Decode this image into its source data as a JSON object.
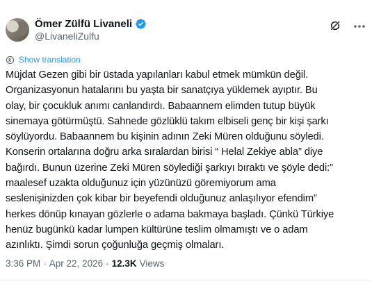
{
  "author": {
    "display_name": "Ömer Zülfü Livaneli",
    "handle": "@LivaneliZulfu",
    "verified_color": "#1d9bf0"
  },
  "header_icons": [
    "grok-icon",
    "more-icon"
  ],
  "translate": {
    "label": "Show translation",
    "icon": "translate-icon"
  },
  "tweet": {
    "text": "Müjdat Gezen gibi bir üstada yapılanları kabul etmek mümkün değil.\nOrganizasyonun hatalarını bu yaşta bir sanatçıya yüklemek ayıptır. Bu\nolay, bir çocukluk anımı canlandırdı. Babaannem elimden tutup büyük\nsinemaya götürmüştü. Sahnede gözlüklü takım elbiseli genç bir kişi şarkı\nsöylüyordu. Babaannem bu kişinin adının Zeki Müren olduğunu söyledi.\nKonserin ortalarına doğru arka sıralardan  birisi “ Helal Zekiye abla” diye\nbağırdı.  Bunun üzerine Zeki Müren söylediği şarkıyı bıraktı ve şöyle dedi:”\nmaalesef uzakta olduğunuz için yüzünüzü göremiyorum ama\nseslenişinizden çok kibar bir beyefendi olduğunuz anlaşılıyor efendim”\nherkes dönüp kınayan gözlerle o adama bakmaya başladı. Çünkü Türkiye\nhenüz bugünkü kadar lumpen kültürüne teslim olmamıştı ve o adam\nazınlıktı. Şimdi sorun çoğunluğa geçmiş olmaları."
  },
  "meta": {
    "time": "3:36 PM",
    "separator": "·",
    "date": "Apr 22, 2026",
    "views_count": "12.3K",
    "views_label": "Views"
  }
}
